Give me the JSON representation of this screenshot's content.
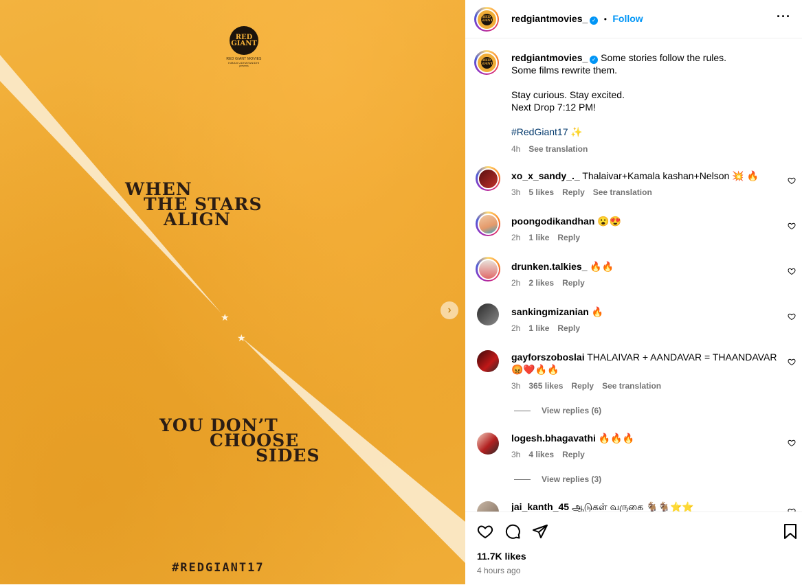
{
  "poster": {
    "logo_text_top": "RED",
    "logo_text_bottom": "GIANT",
    "logo_name": "RED GIANT MOVIES",
    "logo_sub": "INBAN UDHAYANIDHI",
    "logo_presents": "presents",
    "headline_1": [
      "WHEN",
      "THE STARS",
      "ALIGN"
    ],
    "headline_2": [
      "YOU DON’T",
      "CHOOSE",
      "SIDES"
    ],
    "hashtag": "#REDGIANT17",
    "next_icon": "chevron-right-icon"
  },
  "header": {
    "username": "redgiantmovies_",
    "dot": "•",
    "follow_label": "Follow",
    "more_icon": "more-horizontal-icon"
  },
  "caption": {
    "username": "redgiantmovies_",
    "line1": "Some stories follow the rules.",
    "line2": "Some films rewrite them.",
    "line3": "Stay curious. Stay excited.",
    "line4": "Next Drop 7:12 PM!",
    "hashtag": "#RedGiant17",
    "emoji": "✨",
    "time": "4h",
    "translate": "See translation"
  },
  "comments": [
    {
      "user": "xo_x_sandy_._",
      "text": "Thalaivar+Kamala kashan+Nelson 💥 🔥",
      "extra": "",
      "time": "3h",
      "likes": "5 likes",
      "reply": "Reply",
      "translate": "See translation"
    },
    {
      "user": "poongodikandhan",
      "text": "😮😍",
      "extra": "",
      "time": "2h",
      "likes": "1 like",
      "reply": "Reply",
      "translate": ""
    },
    {
      "user": "drunken.talkies_",
      "text": "🔥🔥",
      "extra": "",
      "time": "2h",
      "likes": "2 likes",
      "reply": "Reply",
      "translate": ""
    },
    {
      "user": "sankingmizanian",
      "text": "🔥",
      "extra": "",
      "time": "2h",
      "likes": "1 like",
      "reply": "Reply",
      "translate": ""
    },
    {
      "user": "gayforszoboslai",
      "text": "THALAIVAR + AANDAVAR = THAANDAVAR",
      "extra": "😡❤️🔥🔥",
      "time": "3h",
      "likes": "365 likes",
      "reply": "Reply",
      "translate": "See translation"
    },
    {
      "user": "logesh.bhagavathi",
      "text": "🔥🔥🔥",
      "extra": "",
      "time": "3h",
      "likes": "4 likes",
      "reply": "Reply",
      "translate": ""
    },
    {
      "user": "jai_kanth_45",
      "text": "ஆடுகள் வருகை 🐐🐐⭐⭐",
      "extra": "",
      "time": "",
      "likes": "",
      "reply": "",
      "translate": ""
    }
  ],
  "view_replies": [
    "View replies (6)",
    "View replies (3)"
  ],
  "footer": {
    "likes": "11.7K likes",
    "posted": "4 hours ago",
    "icons": [
      "heart-icon",
      "comment-icon",
      "share-icon",
      "bookmark-icon"
    ]
  },
  "colors": {
    "accent": "#0095f6",
    "poster_bg": "#eea62d",
    "poster_text": "#2b1d14"
  }
}
